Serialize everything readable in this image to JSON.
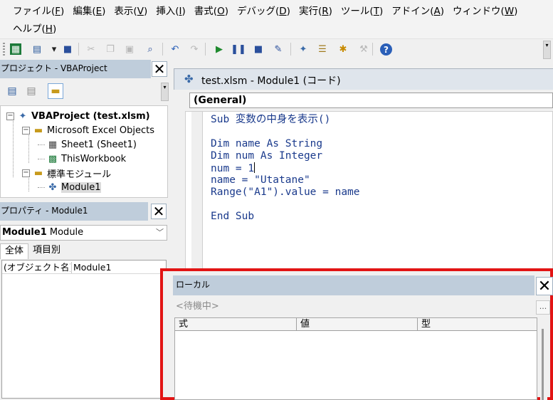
{
  "menubar": {
    "row1": [
      {
        "label": "ファイル(",
        "acc": "F",
        "end": ")"
      },
      {
        "label": "編集(",
        "acc": "E",
        "end": ")"
      },
      {
        "label": "表示(",
        "acc": "V",
        "end": ")"
      },
      {
        "label": "挿入(",
        "acc": "I",
        "end": ")"
      },
      {
        "label": "書式(",
        "acc": "O",
        "end": ")"
      },
      {
        "label": "デバッグ(",
        "acc": "D",
        "end": ")"
      },
      {
        "label": "実行(",
        "acc": "R",
        "end": ")"
      },
      {
        "label": "ツール(",
        "acc": "T",
        "end": ")"
      },
      {
        "label": "アドイン(",
        "acc": "A",
        "end": ")"
      },
      {
        "label": "ウィンドウ(",
        "acc": "W",
        "end": ")"
      }
    ],
    "row2": [
      {
        "label": "ヘルプ(",
        "acc": "H",
        "end": ")"
      }
    ]
  },
  "toolbar": {
    "icons": [
      {
        "name": "excel-view-icon",
        "glyph": "▦",
        "color": "#1d7a3a"
      },
      {
        "name": "insert-module-icon",
        "glyph": "▤",
        "color": "#2a5a9c"
      },
      {
        "name": "dropdown-arrow-icon",
        "glyph": "▾",
        "color": "#222222"
      },
      {
        "name": "save-icon",
        "glyph": "■",
        "color": "#2a4f9c"
      },
      {
        "name": "cut-icon",
        "glyph": "✂",
        "color": "#b8b8b8"
      },
      {
        "name": "copy-icon",
        "glyph": "❐",
        "color": "#b8b8b8"
      },
      {
        "name": "paste-icon",
        "glyph": "▣",
        "color": "#b8b8b8"
      },
      {
        "name": "find-icon",
        "glyph": "⌕",
        "color": "#2a4f9c"
      },
      {
        "name": "undo-icon",
        "glyph": "↶",
        "color": "#2a5fb8"
      },
      {
        "name": "redo-icon",
        "glyph": "↷",
        "color": "#b8b8b8"
      },
      {
        "name": "run-icon",
        "glyph": "▶",
        "color": "#1f8a2e"
      },
      {
        "name": "break-icon",
        "glyph": "❚❚",
        "color": "#2a4f9c"
      },
      {
        "name": "reset-icon",
        "glyph": "■",
        "color": "#2a4f9c"
      },
      {
        "name": "design-mode-icon",
        "glyph": "✎",
        "color": "#2a4f9c"
      },
      {
        "name": "project-explorer-icon",
        "glyph": "✦",
        "color": "#3a6aa8"
      },
      {
        "name": "properties-window-icon",
        "glyph": "☰",
        "color": "#a07a1c"
      },
      {
        "name": "object-browser-icon",
        "glyph": "✱",
        "color": "#c78a00"
      },
      {
        "name": "toolbox-icon",
        "glyph": "⚒",
        "color": "#b8b8b8"
      },
      {
        "name": "help-icon",
        "glyph": "?",
        "color": "#ffffff"
      }
    ]
  },
  "project": {
    "title": "プロジェクト - VBAProject",
    "tree": [
      {
        "label": "VBAProject (test.xlsm)",
        "bold": true,
        "icon": "vbaproject-icon",
        "glyph": "✦"
      },
      {
        "label": "Microsoft Excel Objects",
        "icon": "folder-icon",
        "glyph": "▬"
      },
      {
        "label": "Sheet1 (Sheet1)",
        "icon": "sheet-icon",
        "glyph": "▦"
      },
      {
        "label": "ThisWorkbook",
        "icon": "workbook-icon",
        "glyph": "▩"
      },
      {
        "label": "標準モジュール",
        "icon": "folder-icon",
        "glyph": "▬"
      },
      {
        "label": "Module1",
        "icon": "module-icon",
        "glyph": "✤",
        "selected": true
      }
    ]
  },
  "properties": {
    "title": "プロパティ - Module1",
    "object_name": "Module1",
    "object_type": "Module",
    "tabs": [
      "全体",
      "項目別"
    ],
    "rows": [
      {
        "key": "(オブジェクト名)",
        "value": "Module1"
      }
    ]
  },
  "code_window": {
    "title": "test.xlsm - Module1 (コード)",
    "object_combo": "(General)",
    "lines": [
      "Sub 変数の中身を表示()",
      "",
      "Dim name As String",
      "Dim num As Integer",
      "num = 1",
      "name = \"Utatane\"",
      "Range(\"A1\").value = name",
      "",
      "End Sub"
    ]
  },
  "locals": {
    "title": "ローカル",
    "context": "<待機中>",
    "ellipsis": "...",
    "columns": [
      "式",
      "値",
      "型"
    ]
  },
  "colors": {
    "pane_title_bg": "#bfcddb",
    "code_text": "#1a3a8c",
    "highlight_border": "#e21414"
  }
}
